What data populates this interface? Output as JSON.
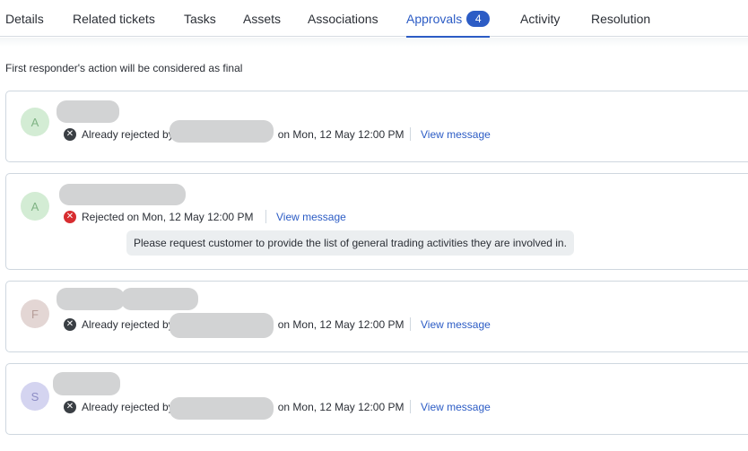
{
  "tabs": [
    {
      "label": "Details"
    },
    {
      "label": "Related tickets"
    },
    {
      "label": "Tasks"
    },
    {
      "label": "Assets"
    },
    {
      "label": "Associations"
    },
    {
      "label": "Approvals",
      "badge": "4"
    },
    {
      "label": "Activity"
    },
    {
      "label": "Resolution"
    }
  ],
  "note": "First responder's action will be considered as final",
  "approvals": [
    {
      "initial": "A",
      "status_prefix": "Already rejected by",
      "status_suffix": "on Mon, 12 May 12:00 PM",
      "link": "View message"
    },
    {
      "initial": "A",
      "status_prefix": "Rejected on Mon, 12 May 12:00 PM",
      "link": "View message",
      "comment": "Please request customer to provide the list of general trading activities they are involved in."
    },
    {
      "initial": "F",
      "status_prefix": "Already rejected by",
      "status_suffix": "on Mon, 12 May 12:00 PM",
      "link": "View message"
    },
    {
      "initial": "S",
      "status_prefix": "Already rejected by",
      "status_suffix": "on Mon, 12 May 12:00 PM",
      "link": "View message"
    }
  ],
  "colors": {
    "accent": "#2c5cc5",
    "avatar_green": "#d3ecd4",
    "avatar_rose": "#e3d6d4",
    "avatar_lavender": "#d4d4f0",
    "rejected_red": "#d72d30"
  },
  "icons": {
    "already_rejected": "dark-x-circle-icon",
    "rejected": "red-x-circle-icon"
  }
}
